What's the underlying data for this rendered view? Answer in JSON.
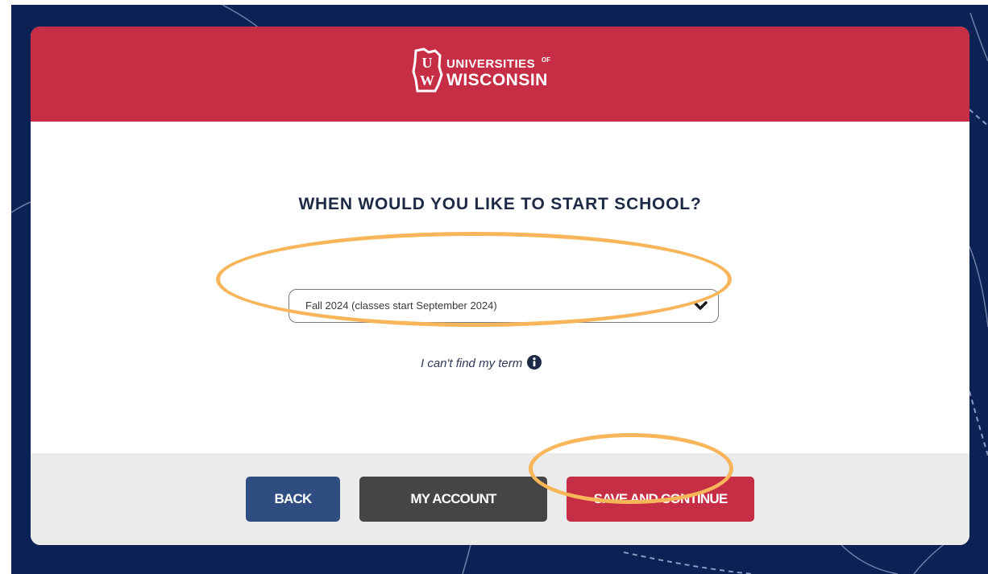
{
  "header": {
    "logo_line1": "UNIVERSITIES",
    "logo_of": "OF",
    "logo_line2": "WISCONSIN",
    "seal_u": "U",
    "seal_w": "W"
  },
  "main": {
    "question": "WHEN WOULD YOU LIKE TO START SCHOOL?",
    "term_select": {
      "selected_value": "Fall 2024 (classes start September 2024)"
    },
    "term_help_link": "I can't find my term"
  },
  "footer": {
    "back_label": "BACK",
    "account_label": "MY ACCOUNT",
    "save_label": "SAVE AND CONTINUE"
  },
  "icons": {
    "dropdown": "chevron-down-icon",
    "help": "info-icon",
    "logo": "wisconsin-state-seal-icon"
  },
  "colors": {
    "background_navy": "#0d2254",
    "brand_red": "#c52e45",
    "back_button_blue": "#2f4d80",
    "account_button_gray": "#454545",
    "highlight_orange": "#f8b55a"
  }
}
